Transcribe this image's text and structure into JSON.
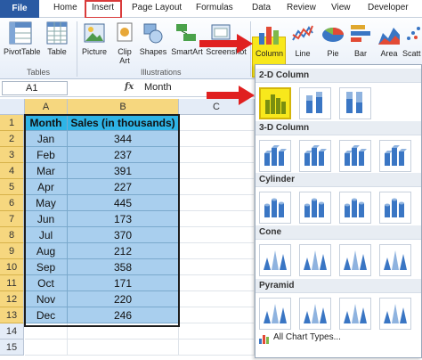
{
  "tabs": {
    "file": "File",
    "items": [
      "Home",
      "Insert",
      "Page Layout",
      "Formulas",
      "Data",
      "Review",
      "View",
      "Developer"
    ]
  },
  "ribbon": {
    "pivottable": "PivotTable",
    "table": "Table",
    "picture": "Picture",
    "clipart_1": "Clip",
    "clipart_2": "Art",
    "shapes": "Shapes",
    "smartart": "SmartArt",
    "screenshot": "Screenshot",
    "column": "Column",
    "line": "Line",
    "pie": "Pie",
    "bar": "Bar",
    "area": "Area",
    "scatter": "Scatt",
    "group_tables": "Tables",
    "group_illustrations": "Illustrations"
  },
  "formula_bar": {
    "name_box": "A1",
    "fx": "fx",
    "value": "Month"
  },
  "grid": {
    "columns": [
      "A",
      "B",
      "C"
    ],
    "header": {
      "month": "Month",
      "sales": "Sales (in thousands)"
    },
    "rows": [
      {
        "n": "1"
      },
      {
        "n": "2",
        "month": "Jan",
        "sales": "344"
      },
      {
        "n": "3",
        "month": "Feb",
        "sales": "237"
      },
      {
        "n": "4",
        "month": "Mar",
        "sales": "391"
      },
      {
        "n": "5",
        "month": "Apr",
        "sales": "227"
      },
      {
        "n": "6",
        "month": "May",
        "sales": "445"
      },
      {
        "n": "7",
        "month": "Jun",
        "sales": "173"
      },
      {
        "n": "8",
        "month": "Jul",
        "sales": "370"
      },
      {
        "n": "9",
        "month": "Aug",
        "sales": "212"
      },
      {
        "n": "10",
        "month": "Sep",
        "sales": "358"
      },
      {
        "n": "11",
        "month": "Oct",
        "sales": "171"
      },
      {
        "n": "12",
        "month": "Nov",
        "sales": "220"
      },
      {
        "n": "13",
        "month": "Dec",
        "sales": "246"
      },
      {
        "n": "14"
      },
      {
        "n": "15"
      }
    ]
  },
  "gallery": {
    "sections": [
      "2-D Column",
      "3-D Column",
      "Cylinder",
      "Cone",
      "Pyramid"
    ],
    "all_chart_types": "All Chart Types..."
  },
  "colors": {
    "file_tab": "#2a5aa3",
    "highlight": "#f8e81c",
    "arrow": "#e02020",
    "header_cell": "#2fb4e6",
    "data_cell": "#a9cfee",
    "selected_header": "#f6d77f"
  }
}
